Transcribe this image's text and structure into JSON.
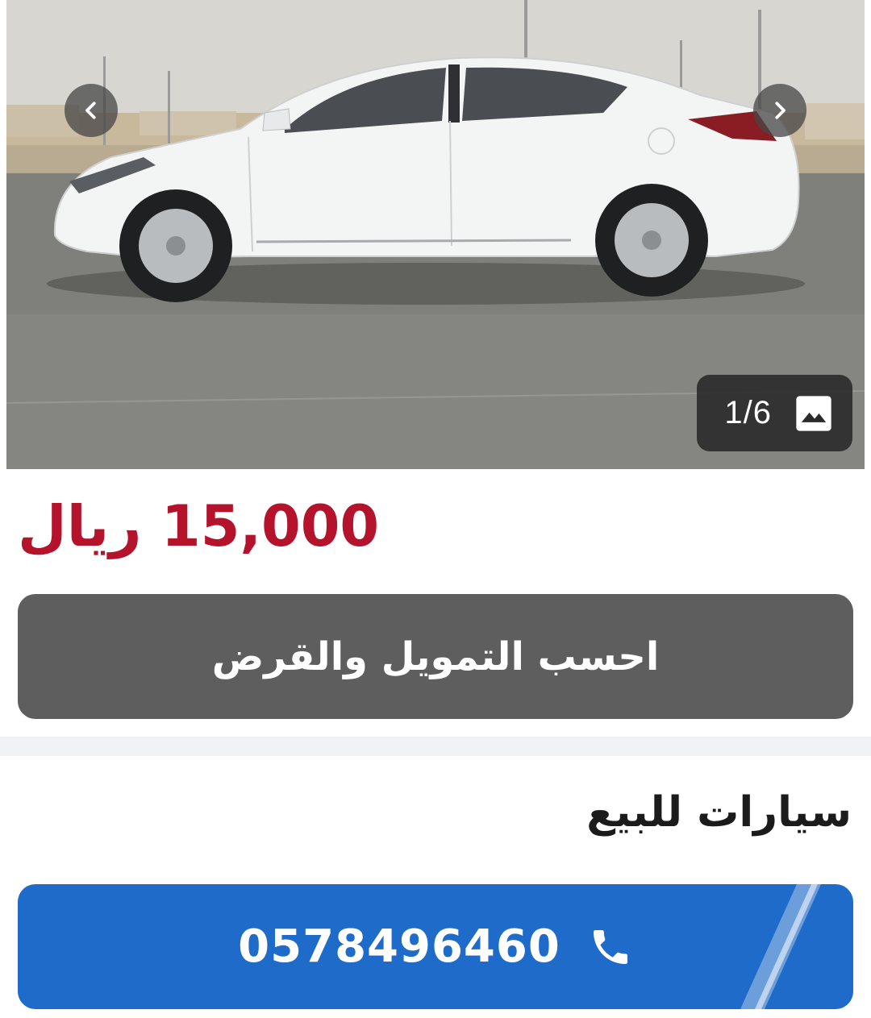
{
  "gallery": {
    "counter": "1/6",
    "current_index": 1,
    "total": 6,
    "photo_subject": "white sedan side view on asphalt lot"
  },
  "listing": {
    "price": "15,000 ريال"
  },
  "finance_button": {
    "label": "احسب التمويل والقرض"
  },
  "section": {
    "title": "سيارات للبيع"
  },
  "call_button": {
    "phone": "0578496460"
  },
  "icons": {
    "prev": "chevron-left-icon",
    "next": "chevron-right-icon",
    "gallery": "image-icon",
    "phone": "phone-icon"
  },
  "colors": {
    "price": "#b5132c",
    "finance_button": "#5e5e5e",
    "call_button": "#1f6bc9",
    "divider": "#f1f2f5"
  }
}
